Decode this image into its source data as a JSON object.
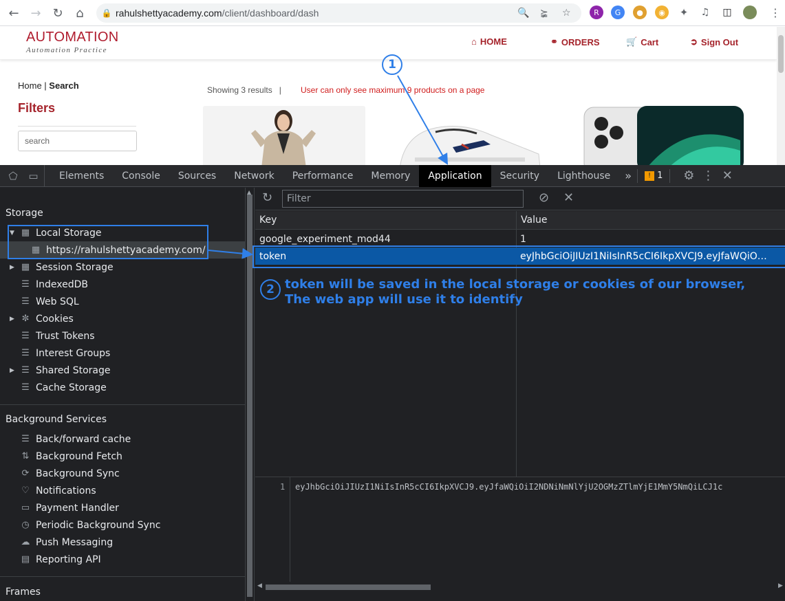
{
  "browser": {
    "url_host": "rahulshettyacademy.com",
    "url_path": "/client/dashboard/dash"
  },
  "site": {
    "brand": "AUTOMATION",
    "brand_sub": "Automation Practice",
    "nav": [
      {
        "label": "HOME",
        "icon": "home-icon"
      },
      {
        "label": "ORDERS",
        "icon": "handshake-icon"
      },
      {
        "label": "Cart",
        "icon": "cart-icon"
      },
      {
        "label": "Sign Out",
        "icon": "sign-out-icon"
      }
    ],
    "breadcrumb_home": "Home",
    "breadcrumb_sep": " | ",
    "breadcrumb_current": "Search",
    "filters_title": "Filters",
    "search_placeholder": "search",
    "showing": "Showing 3 results",
    "showing_sep": "|",
    "note": "User can only see maximum 9 products on a page"
  },
  "devtools": {
    "tabs": [
      "Elements",
      "Console",
      "Sources",
      "Network",
      "Performance",
      "Memory",
      "Application",
      "Security",
      "Lighthouse"
    ],
    "active_tab": "Application",
    "more_tabs": "»",
    "issues_count": "1",
    "sidebar": {
      "storage_heading": "Storage",
      "local_storage": "Local Storage",
      "local_storage_origin": "https://rahulshettyacademy.com/",
      "storage_items": [
        "Session Storage",
        "IndexedDB",
        "Web SQL",
        "Cookies",
        "Trust Tokens",
        "Interest Groups",
        "Shared Storage",
        "Cache Storage"
      ],
      "background_heading": "Background Services",
      "background_items": [
        "Back/forward cache",
        "Background Fetch",
        "Background Sync",
        "Notifications",
        "Payment Handler",
        "Periodic Background Sync",
        "Push Messaging",
        "Reporting API"
      ],
      "frames_heading": "Frames"
    },
    "filter_placeholder": "Filter",
    "columns": {
      "key": "Key",
      "value": "Value"
    },
    "rows": [
      {
        "key": "google_experiment_mod44",
        "value": "1"
      },
      {
        "key": "token",
        "value": "eyJhbGciOiJIUzI1NiIsInR5cCI6IkpXVCJ9.eyJfaWQiO…"
      }
    ],
    "preview": {
      "line": "1",
      "code": "eyJhbGciOiJIUzI1NiIsInR5cCI6IkpXVCJ9.eyJfaWQiOiI2NDNiNmNlYjU2OGMzZTlmYjE1MmY5NmQiLCJ1c"
    }
  },
  "annotations": {
    "step1": "1",
    "step2": "2",
    "text_line1": "token will be saved  in the local storage or cookies of our browser,",
    "text_line2": "The web app will use it to identify",
    "color": "#2f7fe8"
  }
}
